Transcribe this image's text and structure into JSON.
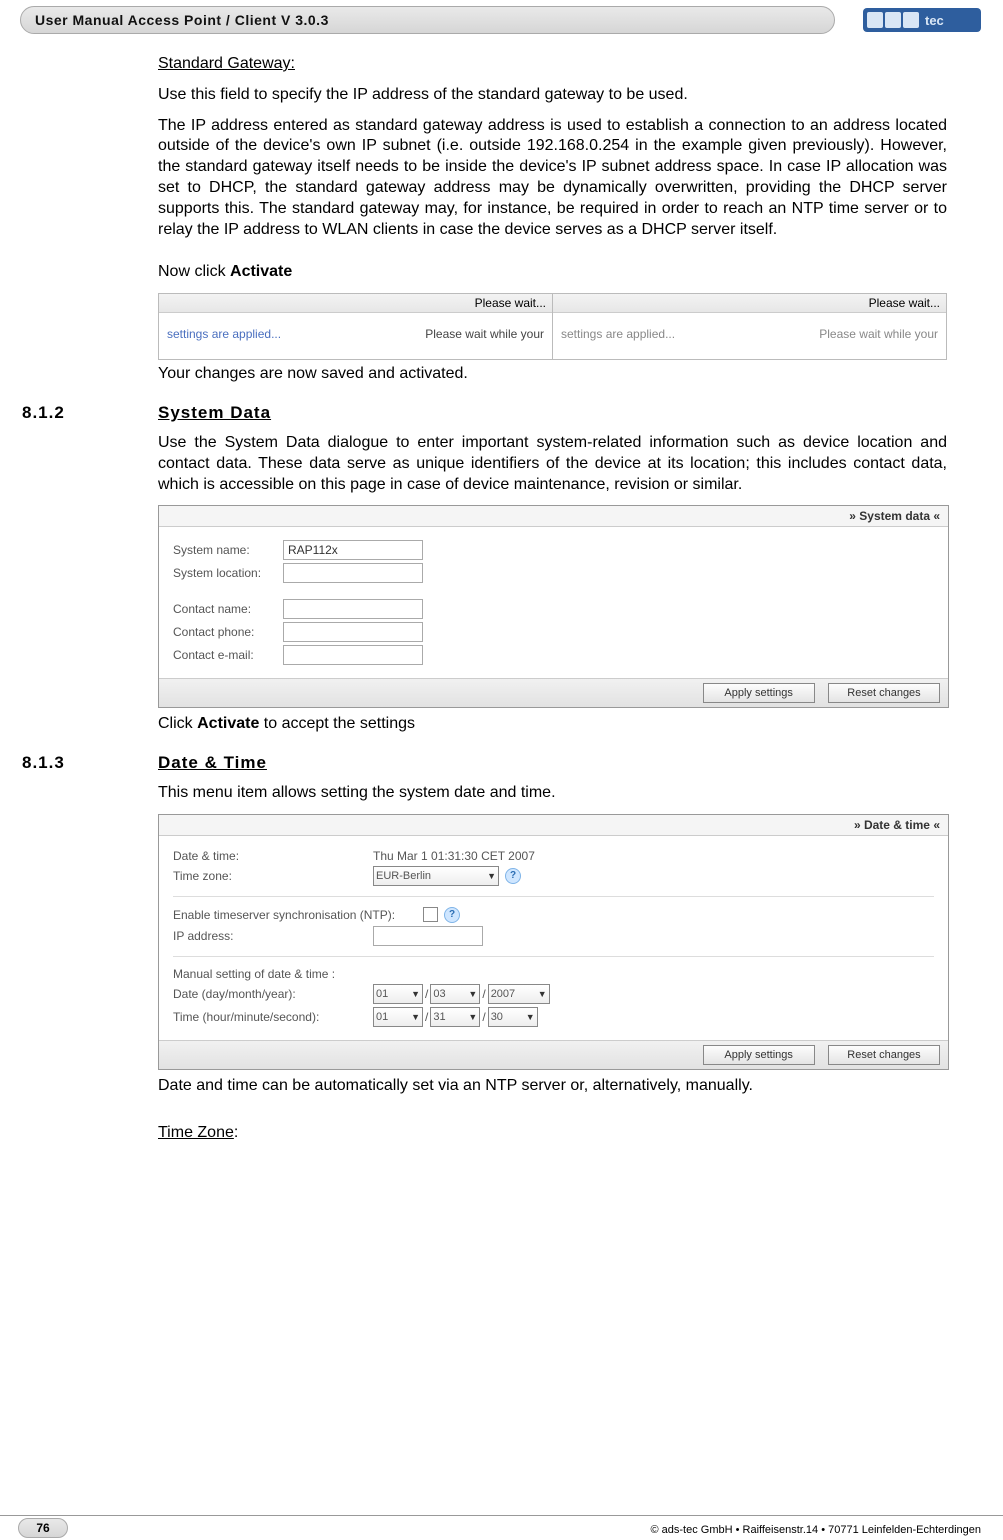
{
  "header": {
    "title": "User Manual Access Point / Client V 3.0.3",
    "brand_name": "adstec"
  },
  "gateway": {
    "heading": "Standard Gateway:",
    "p1": "Use this field to specify the IP address of the standard gateway to be used.",
    "p2": "The IP address entered as standard gateway address is used to establish a connection to an address located outside of the device's own IP subnet (i.e. outside 192.168.0.254 in the example given previously). However, the standard gateway itself needs to be inside the device's IP subnet address space. In case IP allocation was set to DHCP, the standard gateway address may be dynamically overwritten, providing the DHCP server supports this. The standard gateway may, for instance, be required in order to reach an NTP time server or to relay the IP address to WLAN clients in case the device serves as a DHCP server itself.",
    "p3a": "Now click ",
    "p3b": "Activate",
    "save_msg": "Your changes are now saved and activated.",
    "please_wait": "Please wait...",
    "left_a": "settings are applied...",
    "left_b": "Please wait while your",
    "right_a": "settings are applied...",
    "right_b": "Please wait while your"
  },
  "sec812": {
    "num": "8.1.2",
    "title": "System Data",
    "p1": "Use the System Data dialogue to enter important system-related information such as device location and contact data. These data serve as unique identifiers of the device at its location; this includes contact data, which is accessible on this page in case of device maintenance, revision or similar.",
    "panel": {
      "header": "» System data «",
      "rows": {
        "system_name_lbl": "System name:",
        "system_name_val": "RAP112x",
        "system_loc_lbl": "System location:",
        "contact_name_lbl": "Contact name:",
        "contact_phone_lbl": "Contact phone:",
        "contact_email_lbl": "Contact e-mail:"
      },
      "apply": "Apply settings",
      "reset": "Reset changes"
    },
    "p2a": "Click ",
    "p2b": "Activate",
    "p2c": " to accept the settings"
  },
  "sec813": {
    "num": "8.1.3",
    "title": "Date & Time",
    "p1": "This menu item allows setting the system date and time.",
    "panel": {
      "header": "» Date & time «",
      "dt_lbl": "Date & time:",
      "dt_val": "Thu Mar 1 01:31:30 CET 2007",
      "tz_lbl": "Time zone:",
      "tz_val": "EUR-Berlin",
      "ntp_lbl": "Enable timeserver synchronisation (NTP):",
      "ip_lbl": "IP address:",
      "manual_lbl": "Manual setting of date & time :",
      "date_lbl": "Date (day/month/year):",
      "time_lbl": "Time (hour/minute/second):",
      "date_vals": [
        "01",
        "03",
        "2007"
      ],
      "time_vals": [
        "01",
        "31",
        "30"
      ],
      "apply": "Apply settings",
      "reset": "Reset changes"
    },
    "p2": "Date and time can be automatically set via an NTP server or, alternatively, manually.",
    "tz_heading": "Time Zone"
  },
  "footer": {
    "page": "76",
    "copyright": "© ads-tec GmbH • Raiffeisenstr.14 • 70771 Leinfelden-Echterdingen"
  }
}
